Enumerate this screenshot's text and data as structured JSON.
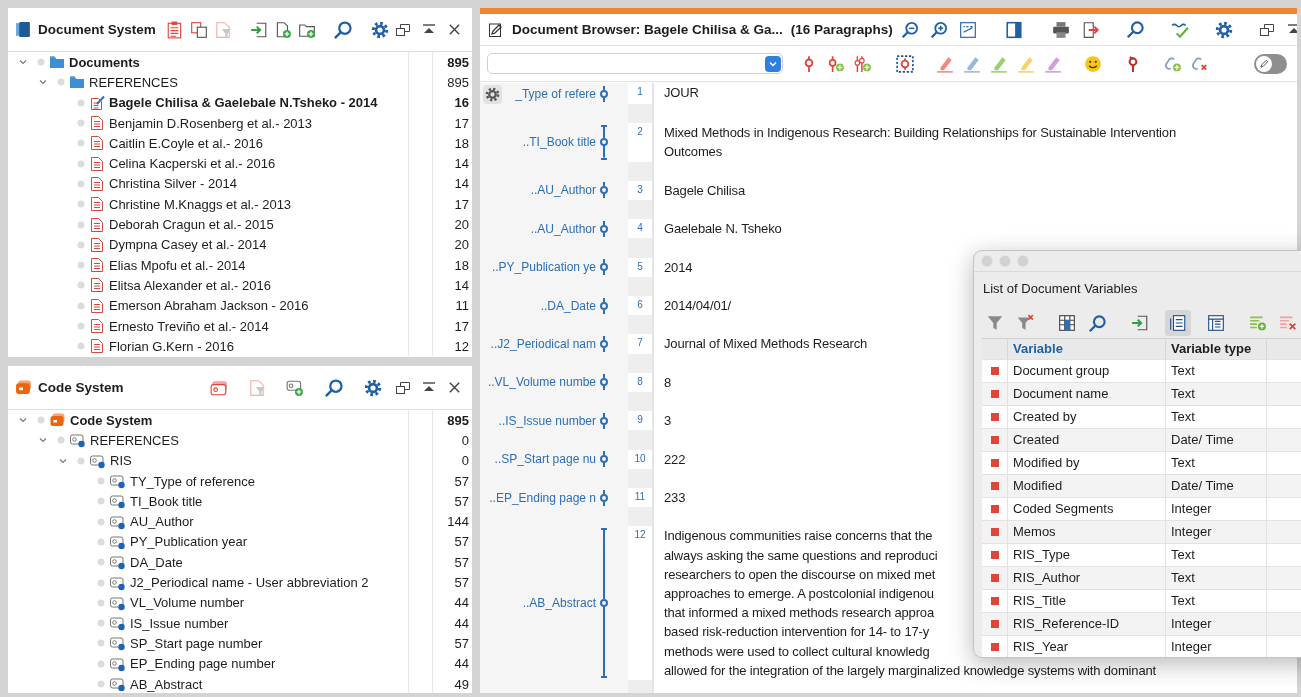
{
  "document_system": {
    "title": "Document System",
    "tree": [
      {
        "label": "Documents",
        "count": "895",
        "kind": "documents-root",
        "expanded": true,
        "children": [
          {
            "label": "REFERENCES",
            "count": "895",
            "kind": "document-group",
            "expanded": true,
            "children": [
              {
                "label": "Bagele Chilisa & Gaelebale N.Tsheko - 2014",
                "count": "16",
                "kind": "document",
                "active": true
              },
              {
                "label": "Benjamin D.Rosenberg et al.- 2013",
                "count": "17",
                "kind": "document",
                "active": false
              },
              {
                "label": "Caitlin E.Coyle et al.- 2016",
                "count": "18",
                "kind": "document",
                "active": false
              },
              {
                "label": "Celina Kacperski et al.- 2016",
                "count": "14",
                "kind": "document",
                "active": false
              },
              {
                "label": "Christina Silver - 2014",
                "count": "14",
                "kind": "document",
                "active": false
              },
              {
                "label": "Christine M.Knaggs et al.- 2013",
                "count": "17",
                "kind": "document",
                "active": false
              },
              {
                "label": "Deborah Cragun et al.- 2015",
                "count": "20",
                "kind": "document",
                "active": false
              },
              {
                "label": "Dympna Casey et al.- 2014",
                "count": "20",
                "kind": "document",
                "active": false
              },
              {
                "label": "Elias Mpofu et al.- 2014",
                "count": "18",
                "kind": "document",
                "active": false
              },
              {
                "label": "Elitsa Alexander et al.- 2016",
                "count": "14",
                "kind": "document",
                "active": false
              },
              {
                "label": "Emerson Abraham Jackson - 2016",
                "count": "11",
                "kind": "document",
                "active": false
              },
              {
                "label": "Ernesto Treviño et al.- 2014",
                "count": "17",
                "kind": "document",
                "active": false
              },
              {
                "label": "Florian G.Kern - 2016",
                "count": "12",
                "kind": "document",
                "active": false
              }
            ]
          }
        ]
      }
    ]
  },
  "code_system": {
    "title": "Code System",
    "tree": [
      {
        "label": "Code System",
        "count": "895",
        "kind": "codes-root",
        "expanded": true,
        "children": [
          {
            "label": "REFERENCES",
            "count": "0",
            "kind": "code",
            "expanded": true,
            "children": [
              {
                "label": "RIS",
                "count": "0",
                "kind": "code",
                "expanded": true,
                "children": [
                  {
                    "label": "TY_Type of reference",
                    "count": "57",
                    "kind": "code"
                  },
                  {
                    "label": "TI_Book title",
                    "count": "57",
                    "kind": "code"
                  },
                  {
                    "label": "AU_Author",
                    "count": "144",
                    "kind": "code"
                  },
                  {
                    "label": "PY_Publication year",
                    "count": "57",
                    "kind": "code"
                  },
                  {
                    "label": "DA_Date",
                    "count": "57",
                    "kind": "code"
                  },
                  {
                    "label": "J2_Periodical name - User abbreviation 2",
                    "count": "57",
                    "kind": "code"
                  },
                  {
                    "label": "VL_Volume number",
                    "count": "44",
                    "kind": "code"
                  },
                  {
                    "label": "IS_Issue number",
                    "count": "44",
                    "kind": "code"
                  },
                  {
                    "label": "SP_Start page number",
                    "count": "57",
                    "kind": "code"
                  },
                  {
                    "label": "EP_Ending page number",
                    "count": "44",
                    "kind": "code"
                  },
                  {
                    "label": "AB_Abstract",
                    "count": "49",
                    "kind": "code"
                  }
                ]
              }
            ]
          }
        ]
      }
    ]
  },
  "document_browser": {
    "title": "Document Browser: Bagele Chilisa & Ga...",
    "paragraph_count": "(16 Paragraphs)",
    "edit_mode": {
      "on": false
    },
    "paragraphs": [
      {
        "number": "1",
        "code": "_Type of refere",
        "kind": "point",
        "text": "JOUR"
      },
      {
        "number": "2",
        "code": "..TI_Book title",
        "kind": "span",
        "text": "Mixed Methods in Indigenous Research: Building Relationships for Sustainable Intervention Outcomes"
      },
      {
        "number": "3",
        "code": "..AU_Author",
        "kind": "point",
        "text": "Bagele Chilisa"
      },
      {
        "number": "4",
        "code": "..AU_Author",
        "kind": "point",
        "text": "Gaelebale N. Tsheko"
      },
      {
        "number": "5",
        "code": "..PY_Publication ye",
        "kind": "point",
        "text": "2014"
      },
      {
        "number": "6",
        "code": "..DA_Date",
        "kind": "point",
        "text": "2014/04/01/"
      },
      {
        "number": "7",
        "code": "..J2_Periodical nam",
        "kind": "point",
        "text": "Journal of Mixed Methods Research"
      },
      {
        "number": "8",
        "code": "..VL_Volume numbe",
        "kind": "point",
        "text": "8"
      },
      {
        "number": "9",
        "code": "..IS_Issue number",
        "kind": "point",
        "text": "3"
      },
      {
        "number": "10",
        "code": "..SP_Start page nu",
        "kind": "point",
        "text": "222"
      },
      {
        "number": "11",
        "code": "..EP_Ending page n",
        "kind": "point",
        "text": "233"
      },
      {
        "number": "12",
        "code": "..AB_Abstract",
        "kind": "span",
        "lines": [
          "Indigenous communities raise concerns that the",
          "always asking the same questions and reproduci",
          "researchers to open the discourse on mixed met",
          "approaches to emerge. A postcolonial indigenou",
          "that informed a mixed methods research approa",
          "based risk-reduction intervention for 14- to 17-y",
          "methods were used to collect cultural knowledg",
          "allowed for the integration of the largely marginalized knowledge systems with dominant"
        ]
      }
    ]
  },
  "variables_dialog": {
    "title": "List of Document Variables",
    "columns": [
      {
        "label": "Variable",
        "sorted": true
      },
      {
        "label": "Variable type",
        "sorted": false
      }
    ],
    "rows": [
      {
        "variable": "Document group",
        "type": "Text"
      },
      {
        "variable": "Document name",
        "type": "Text"
      },
      {
        "variable": "Created by",
        "type": "Text"
      },
      {
        "variable": "Created",
        "type": "Date/ Time"
      },
      {
        "variable": "Modified by",
        "type": "Text"
      },
      {
        "variable": "Modified",
        "type": "Date/ Time"
      },
      {
        "variable": "Coded Segments",
        "type": "Integer"
      },
      {
        "variable": "Memos",
        "type": "Integer"
      },
      {
        "variable": "RIS_Type",
        "type": "Text"
      },
      {
        "variable": "RIS_Author",
        "type": "Text"
      },
      {
        "variable": "RIS_Title",
        "type": "Text"
      },
      {
        "variable": "RIS_Reference-ID",
        "type": "Integer"
      },
      {
        "variable": "RIS_Year",
        "type": "Integer"
      }
    ]
  }
}
